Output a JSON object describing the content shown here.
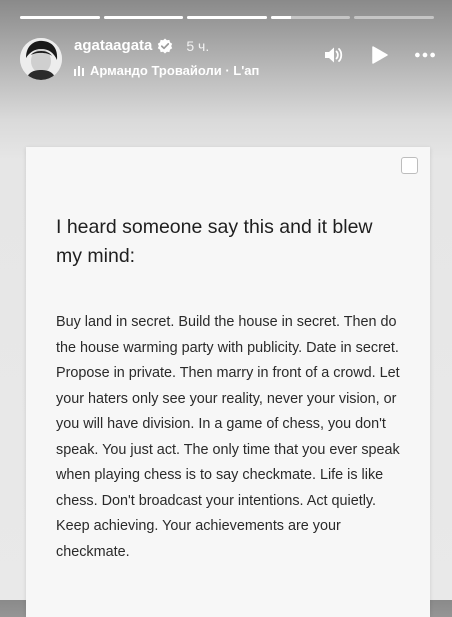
{
  "progress": {
    "segments": [
      {
        "fill": 1.0
      },
      {
        "fill": 1.0
      },
      {
        "fill": 1.0
      },
      {
        "fill": 0.25
      },
      {
        "fill": 0.0
      }
    ]
  },
  "header": {
    "username": "agataagata",
    "time": "5 ч.",
    "music_text": "Армандо Тровайоли · L'ап"
  },
  "icons": {
    "avatar": "avatar-photo",
    "verified": "verified-badge-icon",
    "music": "music-bars-icon",
    "sound": "speaker-icon",
    "play": "play-icon",
    "more": "more-dots-icon"
  },
  "post": {
    "title": "I heard someone say this and it blew my mind:",
    "body": "Buy land in secret. Build the house in secret. Then do the house warming party with publicity. Date in secret. Propose in private. Then marry in front of a crowd. Let your haters only see your reality, never your vision, or you will have division. In a game of chess, you don't speak. You just act. The only time that you ever speak when playing chess is to say checkmate. Life is like chess. Don't broadcast your intentions. Act quietly. Keep achieving. Your achievements are your checkmate."
  }
}
